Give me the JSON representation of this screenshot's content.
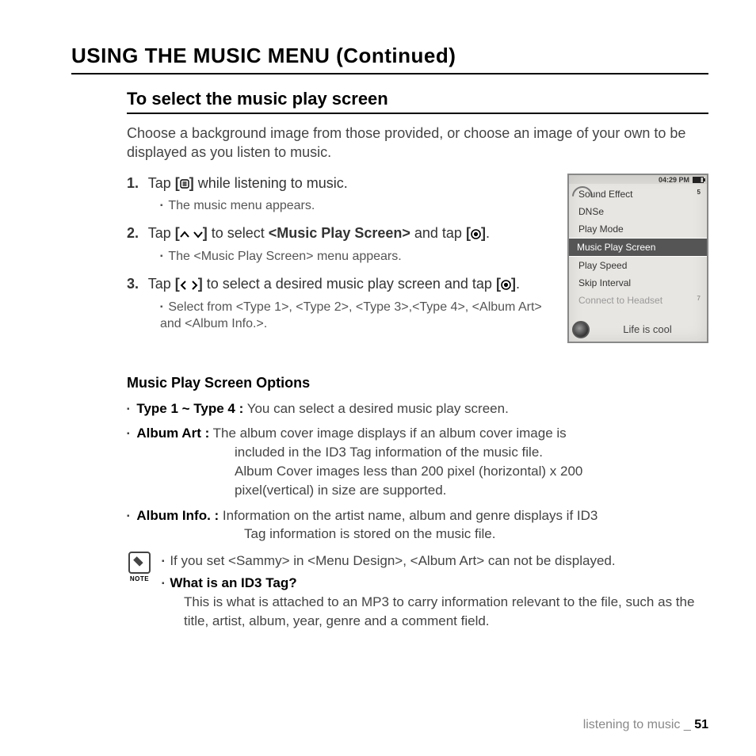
{
  "page_title": "USING THE MUSIC MENU (Continued)",
  "section_title": "To select the music play screen",
  "intro": "Choose a background image from those provided, or choose an image of your own to be displayed as you listen to music.",
  "steps": [
    {
      "num": "1.",
      "pre": "Tap ",
      "icon": "menu",
      "post": " while listening to music.",
      "sub": "The music menu appears."
    },
    {
      "num": "2.",
      "pre": "Tap ",
      "icon": "updown",
      "mid": " to select ",
      "bold": "<Music Play Screen>",
      "post2": " and tap ",
      "icon2": "select",
      "end": ".",
      "sub": "The <Music Play Screen> menu appears."
    },
    {
      "num": "3.",
      "pre": "Tap ",
      "icon": "leftright",
      "mid": " to select a desired music play screen and tap ",
      "icon2": "select",
      "end": ".",
      "sub": "Select from <Type 1>, <Type 2>, <Type 3>,<Type 4>, <Album Art> and <Album Info.>."
    }
  ],
  "device": {
    "time": "04:29 PM",
    "items": [
      "Sound Effect",
      "DNSe",
      "Play Mode",
      "Music Play Screen",
      "Play Speed",
      "Skip Interval",
      "Connect to Headset"
    ],
    "selected_index": 3,
    "side_top": "5",
    "side_bot": "7",
    "footer": "Life is cool"
  },
  "options_title": "Music Play Screen Options",
  "options": [
    {
      "label": "Type 1 ~ Type 4 :",
      "text": " You can select a desired music play screen."
    },
    {
      "label": "Album Art :",
      "text": " The album cover image displays if an album cover image is included in the ID3 Tag information of the music file. Album Cover images less than 200 pixel (horizontal) x 200 pixel(vertical) in size are supported."
    },
    {
      "label": "Album Info. :",
      "text": " Information on the artist name, album and genre displays if ID3 Tag information is stored on the music file."
    }
  ],
  "note_label": "NOTE",
  "notes": [
    {
      "text": "If you set <Sammy> in <Menu Design>, <Album Art> can not be displayed."
    },
    {
      "label": "What is an ID3 Tag?",
      "text": "This is what is attached to an MP3 to carry information relevant to the file, such as the title, artist, album, year, genre and a comment field."
    }
  ],
  "footer_section": "listening to music _ ",
  "footer_page": "51"
}
